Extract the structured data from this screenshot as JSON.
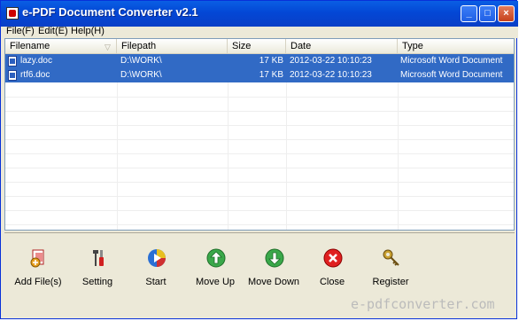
{
  "window": {
    "title": "e-PDF Document Converter v2.1",
    "controls": {
      "minimize": "_",
      "maximize": "□",
      "close": "×"
    }
  },
  "menu": [
    "File(F)",
    "Edit(E)",
    "Help(H)"
  ],
  "table": {
    "columns": [
      "Filename",
      "Filepath",
      "Size",
      "Date",
      "Type"
    ],
    "rows": [
      {
        "filename": "lazy.doc",
        "filepath": "D:\\WORK\\",
        "size": "17 KB",
        "date": "2012-03-22 10:10:23",
        "type": "Microsoft Word Document"
      },
      {
        "filename": "rtf6.doc",
        "filepath": "D:\\WORK\\",
        "size": "17 KB",
        "date": "2012-03-22 10:10:23",
        "type": "Microsoft Word Document"
      }
    ]
  },
  "toolbar": {
    "add_files": "Add File(s)",
    "setting": "Setting",
    "start": "Start",
    "move_up": "Move Up",
    "move_down": "Move Down",
    "close": "Close",
    "register": "Register"
  },
  "watermark": "e-pdfconverter.com",
  "colors": {
    "title_bar": "#0a5fe4",
    "selection": "#316ac5",
    "window_bg": "#ece9d8"
  }
}
